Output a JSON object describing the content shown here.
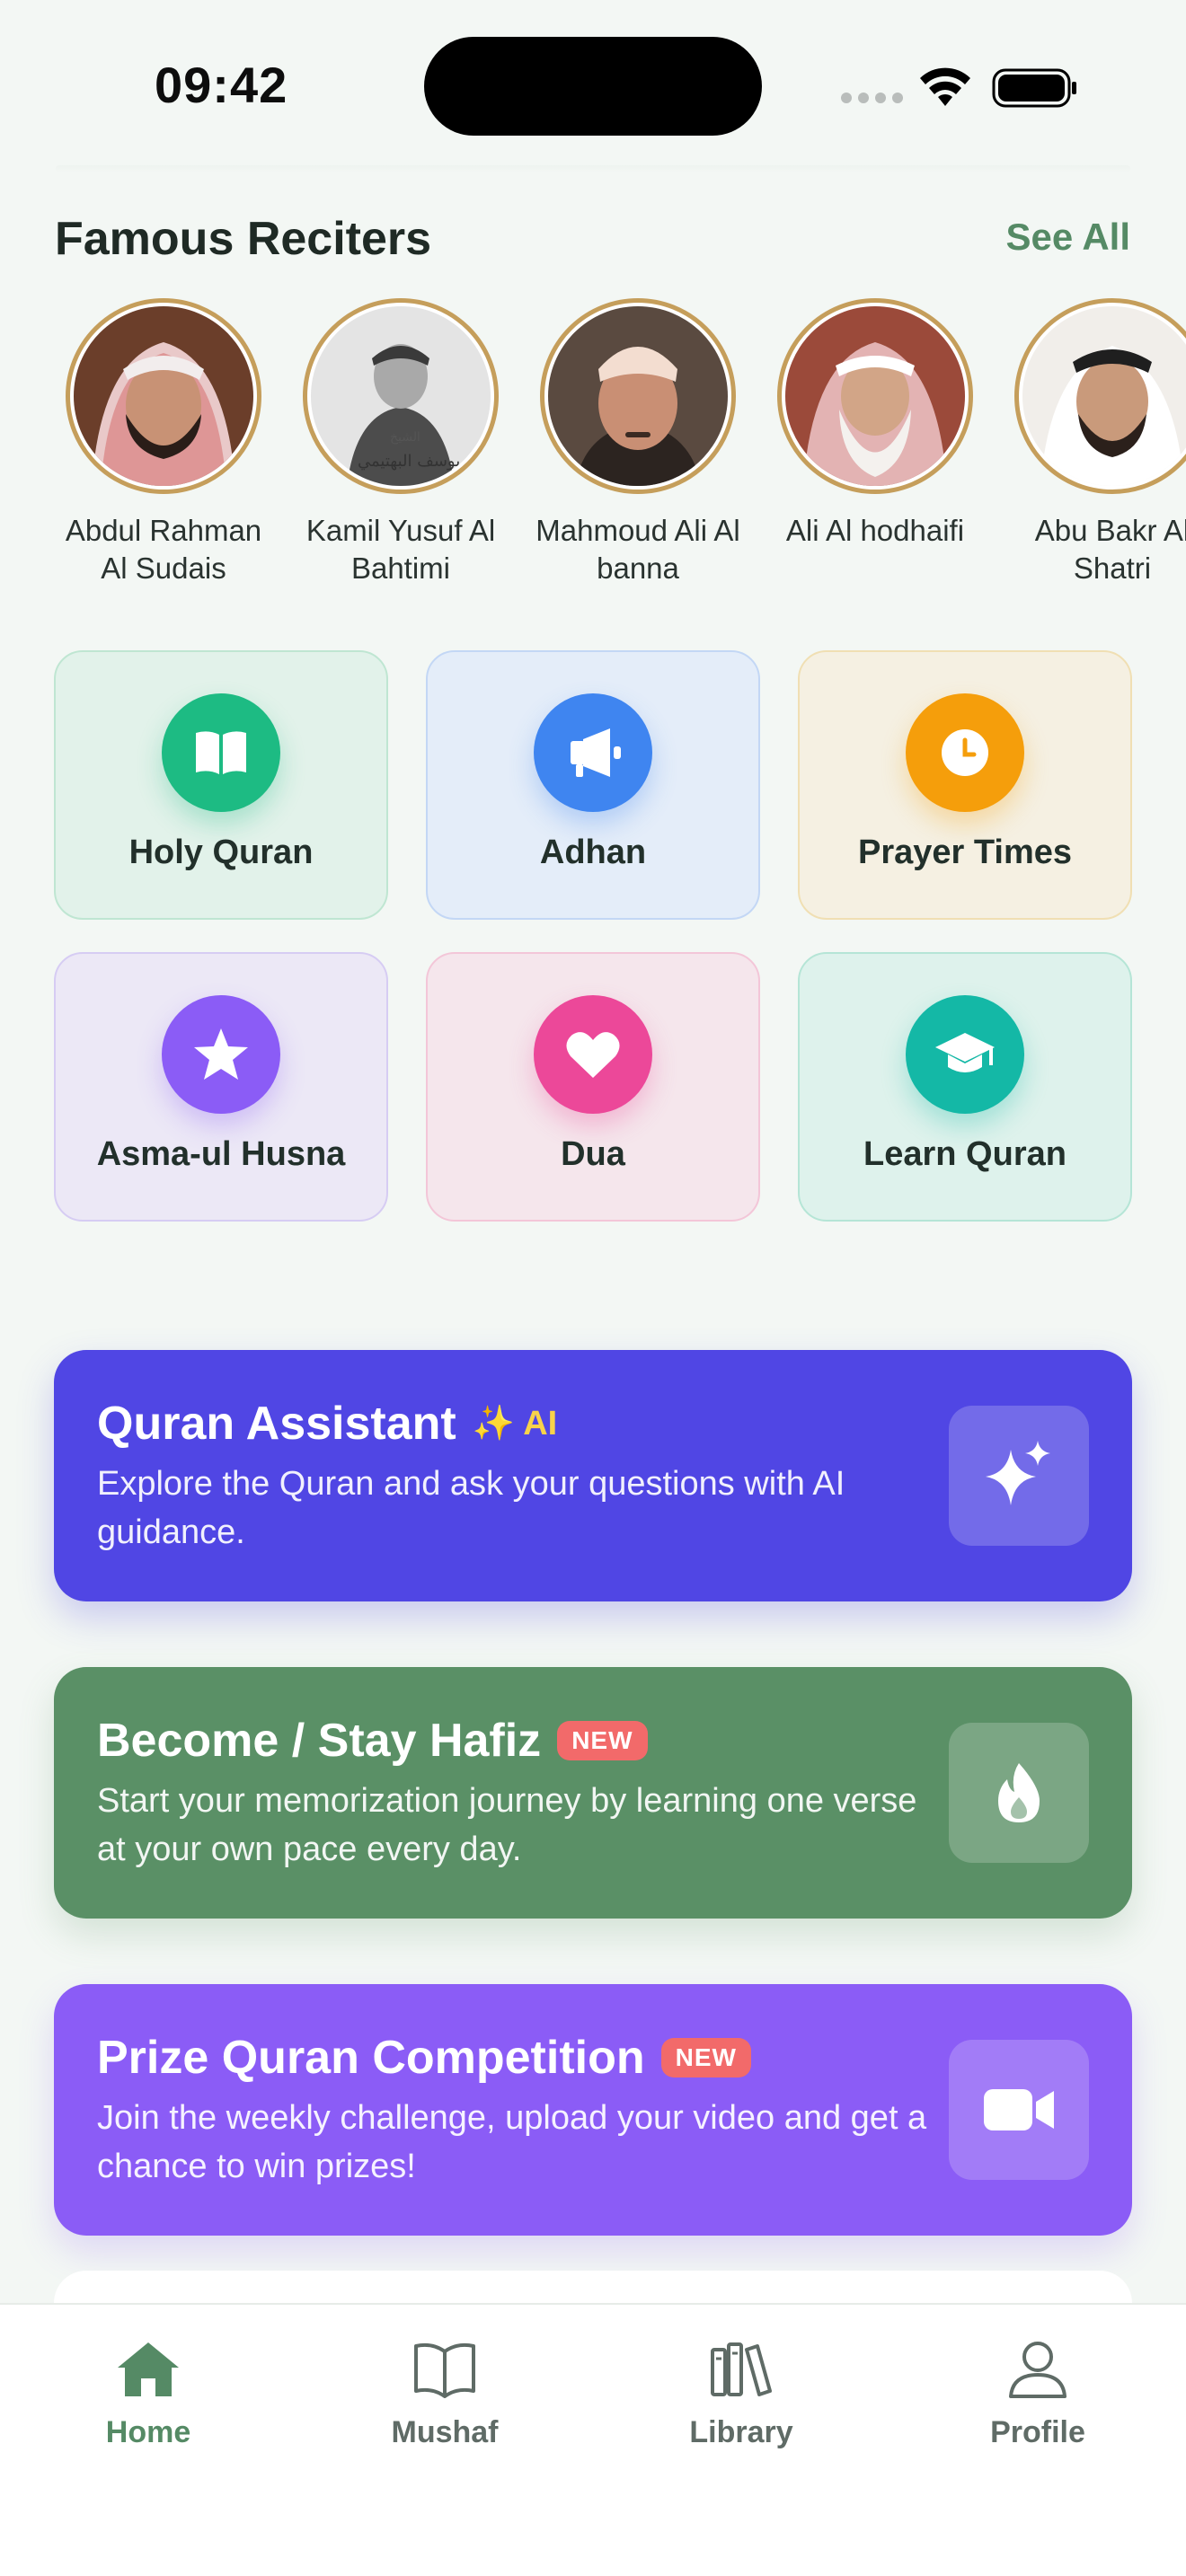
{
  "status_bar": {
    "time": "09:42"
  },
  "reciters_section": {
    "title": "Famous Reciters",
    "see_all": "See All"
  },
  "reciters": [
    {
      "name": "Abdul Rahman Al Sudais"
    },
    {
      "name": "Kamil Yusuf Al Bahtimi",
      "photo_caption": "الشيخ\nأبو يوسف البهتيمي"
    },
    {
      "name": "Mahmoud Ali Al banna"
    },
    {
      "name": "Ali Al hodhaifi"
    },
    {
      "name": "Abu Bakr Al Shatri"
    }
  ],
  "features": [
    {
      "label": "Holy Quran",
      "icon": "open-book-icon",
      "color": "#1dbb83"
    },
    {
      "label": "Adhan",
      "icon": "megaphone-icon",
      "color": "#3f85f0"
    },
    {
      "label": "Prayer Times",
      "icon": "clock-icon",
      "color": "#f59e0b"
    },
    {
      "label": "Asma-ul Husna",
      "icon": "star-icon",
      "color": "#8b5cf6"
    },
    {
      "label": "Dua",
      "icon": "heart-icon",
      "color": "#ec4899"
    },
    {
      "label": "Learn Quran",
      "icon": "graduation-cap-icon",
      "color": "#14b8a6"
    }
  ],
  "cards": [
    {
      "title": "Quran Assistant",
      "tag": "AI",
      "tag_icon": "sparkles-emoji",
      "description": "Explore the Quran and ask your questions with AI guidance.",
      "icon": "sparkles-icon",
      "color": "#5046e4"
    },
    {
      "title": "Become / Stay Hafiz",
      "badge": "NEW",
      "description": "Start your memorization journey by learning one verse at your own pace every day.",
      "icon": "flame-icon",
      "color": "#5a9066"
    },
    {
      "title": "Prize Quran Competition",
      "badge": "NEW",
      "description": "Join the weekly challenge, upload your video and get a chance to win prizes!",
      "icon": "video-camera-icon",
      "color": "#8b5cf6"
    }
  ],
  "bottom_nav": [
    {
      "label": "Home",
      "icon": "home-icon",
      "active": true
    },
    {
      "label": "Mushaf",
      "icon": "book-icon",
      "active": false
    },
    {
      "label": "Library",
      "icon": "library-icon",
      "active": false
    },
    {
      "label": "Profile",
      "icon": "user-icon",
      "active": false
    }
  ],
  "colors": {
    "accent": "#558a65",
    "inactive": "#5f6b66",
    "avatar_ring": "#c59e5b"
  }
}
